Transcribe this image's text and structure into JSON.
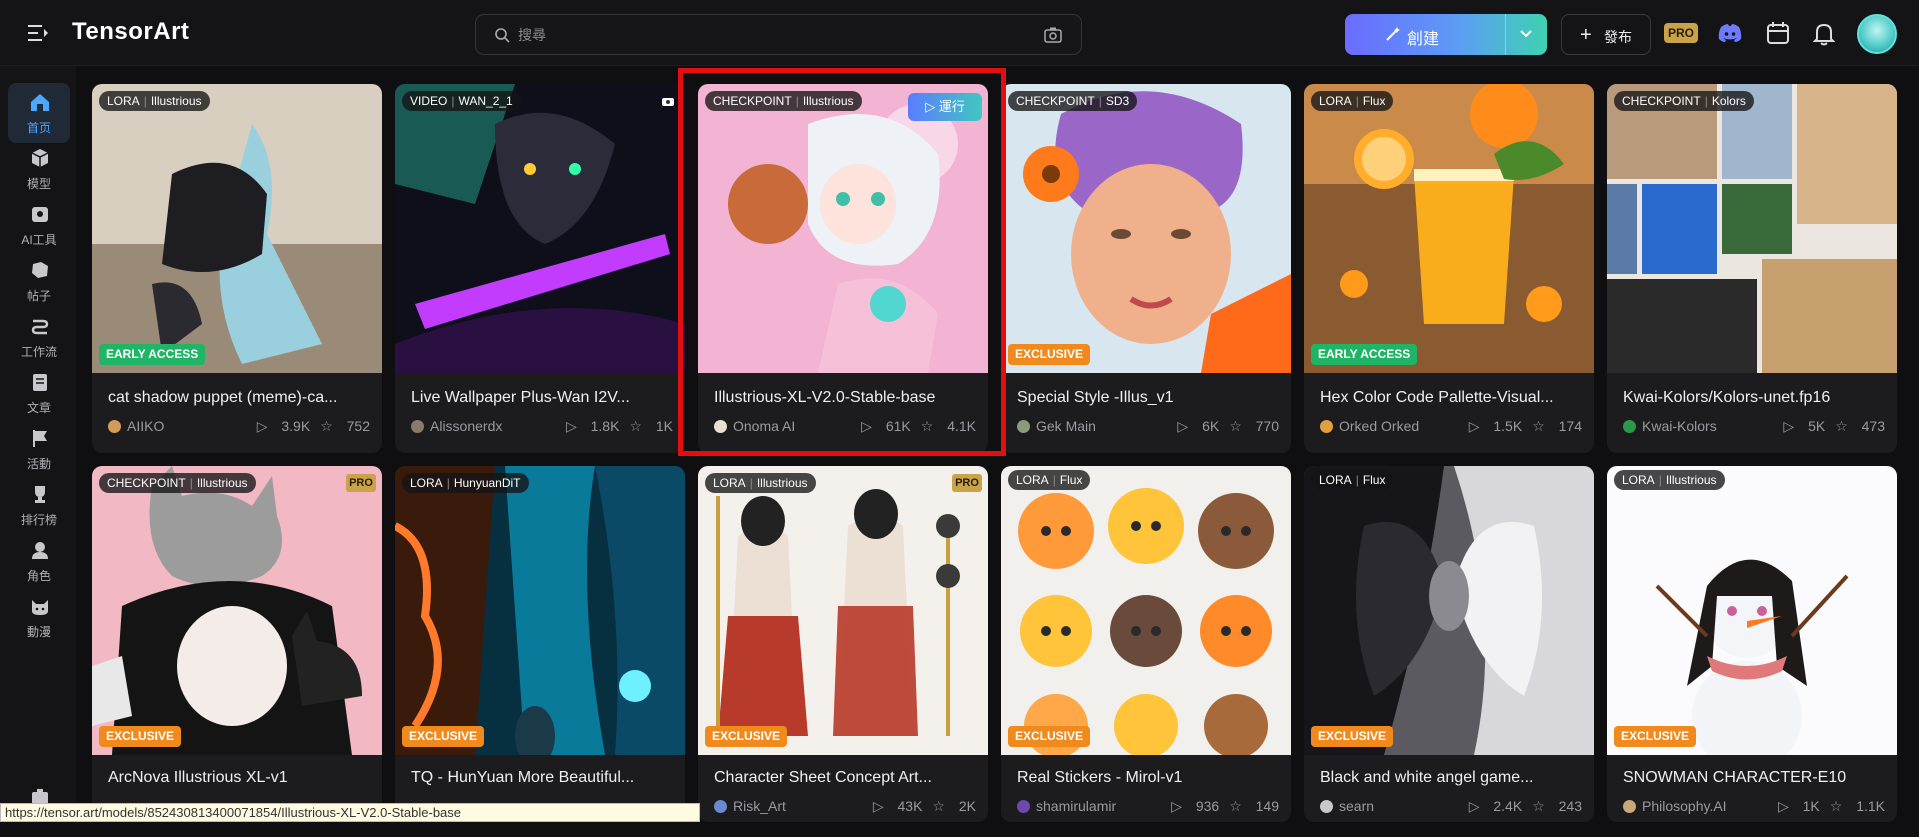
{
  "app": {
    "logo_text": "TensorArt"
  },
  "search": {
    "placeholder": "搜尋"
  },
  "header": {
    "create_label": "創建",
    "publish_label": "發布",
    "pro_label": "PRO"
  },
  "sidebar": {
    "items": [
      {
        "label": "首页",
        "icon": "home-icon"
      },
      {
        "label": "模型",
        "icon": "cube-icon"
      },
      {
        "label": "AI工具",
        "icon": "toolbox-icon"
      },
      {
        "label": "帖子",
        "icon": "post-icon"
      },
      {
        "label": "工作流",
        "icon": "workflow-icon"
      },
      {
        "label": "文章",
        "icon": "article-icon"
      },
      {
        "label": "活動",
        "icon": "flag-icon"
      },
      {
        "label": "排行榜",
        "icon": "trophy-icon"
      },
      {
        "label": "角色",
        "icon": "character-icon"
      },
      {
        "label": "動漫",
        "icon": "anime-icon"
      }
    ]
  },
  "cards": [
    {
      "type": "LORA",
      "base": "Illustrious",
      "badge": "EARLY ACCESS",
      "title": "cat shadow puppet (meme)-ca...",
      "author": "AIIKO",
      "runs": "3.9K",
      "likes": "752"
    },
    {
      "type": "VIDEO",
      "base": "WAN_2_1",
      "badge": "",
      "title": "Live Wallpaper Plus-Wan I2V...",
      "author": "Alissonerdx",
      "runs": "1.8K",
      "likes": "1K"
    },
    {
      "type": "CHECKPOINT",
      "base": "Illustrious",
      "badge": "",
      "run_label": "運行",
      "title": "Illustrious-XL-V2.0-Stable-base",
      "author": "Onoma AI",
      "runs": "61K",
      "likes": "4.1K"
    },
    {
      "type": "CHECKPOINT",
      "base": "SD3",
      "badge": "EXCLUSIVE",
      "title": "Special Style -Illus_v1",
      "author": "Gek Main",
      "runs": "6K",
      "likes": "770"
    },
    {
      "type": "LORA",
      "base": "Flux",
      "badge": "EARLY ACCESS",
      "title": "Hex Color Code Pallette-Visual...",
      "author": "Orked Orked",
      "runs": "1.5K",
      "likes": "174"
    },
    {
      "type": "CHECKPOINT",
      "base": "Kolors",
      "badge": "",
      "title": "Kwai-Kolors/Kolors-unet.fp16",
      "author": "Kwai-Kolors",
      "runs": "5K",
      "likes": "473"
    },
    {
      "type": "CHECKPOINT",
      "base": "Illustrious",
      "badge": "EXCLUSIVE",
      "pro": "PRO",
      "title": "ArcNova Illustrious XL-v1",
      "author": "",
      "runs": "",
      "likes": ""
    },
    {
      "type": "LORA",
      "base": "HunyuanDiT",
      "badge": "EXCLUSIVE",
      "title": "TQ - HunYuan More Beautiful...",
      "author": "",
      "runs": "",
      "likes": ""
    },
    {
      "type": "LORA",
      "base": "Illustrious",
      "badge": "EXCLUSIVE",
      "pro": "PRO",
      "title": "Character Sheet Concept Art...",
      "author": "Risk_Art",
      "runs": "43K",
      "likes": "2K"
    },
    {
      "type": "LORA",
      "base": "Flux",
      "badge": "EXCLUSIVE",
      "title": "Real Stickers - Mirol-v1",
      "author": "shamirulamir",
      "runs": "936",
      "likes": "149"
    },
    {
      "type": "LORA",
      "base": "Flux",
      "badge": "EXCLUSIVE",
      "title": "Black and white angel game...",
      "author": "searn",
      "runs": "2.4K",
      "likes": "243"
    },
    {
      "type": "LORA",
      "base": "Illustrious",
      "badge": "EXCLUSIVE",
      "title": "SNOWMAN CHARACTER-E10",
      "author": "Philosophy.AI",
      "runs": "1K",
      "likes": "1.1K"
    }
  ],
  "status_url": "https://tensor.art/models/852430813400071854/Illustrious-XL-V2.0-Stable-base"
}
